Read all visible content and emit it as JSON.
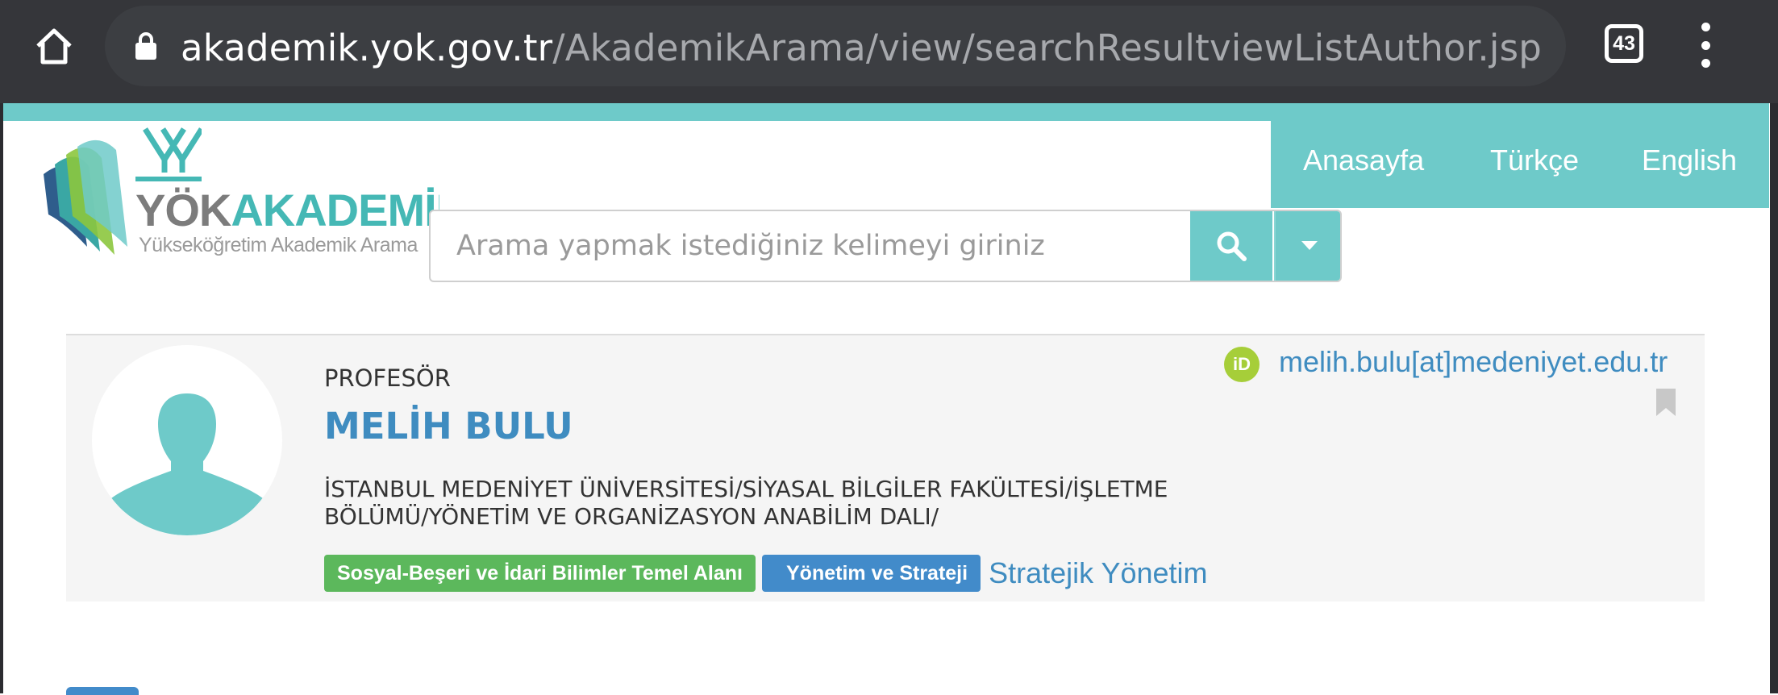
{
  "browser": {
    "url_host": "akademik.yok.gov.tr",
    "url_path": "/AkademikArama/view/searchResultviewListAuthor.jsp",
    "tab_count": "43",
    "icons": [
      "home-icon",
      "lock-icon",
      "tabs-icon",
      "more-vert-icon"
    ]
  },
  "logo": {
    "brand_part1": "YÖK",
    "brand_part2": "AKADEMİK",
    "subtitle": "Yükseköğretim Akademik Arama"
  },
  "nav": {
    "items": [
      {
        "label": "Anasayfa"
      },
      {
        "label": "Türkçe"
      },
      {
        "label": "English"
      }
    ]
  },
  "search": {
    "placeholder": "Arama yapmak istediğiniz kelimeyi giriniz",
    "value": "",
    "icons": [
      "search-icon",
      "caret-down-icon"
    ]
  },
  "profile": {
    "title": "PROFESÖR",
    "name": "MELİH BULU",
    "affiliation": "İSTANBUL MEDENİYET ÜNİVERSİTESİ/SİYASAL BİLGİLER FAKÜLTESİ/İŞLETME BÖLÜMÜ/YÖNETİM VE ORGANİZASYON ANABİLİM DALI/",
    "email": "melih.bulu[at]medeniyet.edu.tr",
    "orcid_label": "iD",
    "tags": [
      {
        "label": "Sosyal-Beşeri ve İdari Bilimler Temel Alanı",
        "color": "#5cb85c"
      },
      {
        "label": "Yönetim ve Strateji",
        "color": "#428bca"
      }
    ],
    "keyword_link": "Stratejik Yönetim"
  },
  "colors": {
    "accent": "#6ecac9",
    "link": "#3f8cc0",
    "chrome": "#35363a"
  }
}
